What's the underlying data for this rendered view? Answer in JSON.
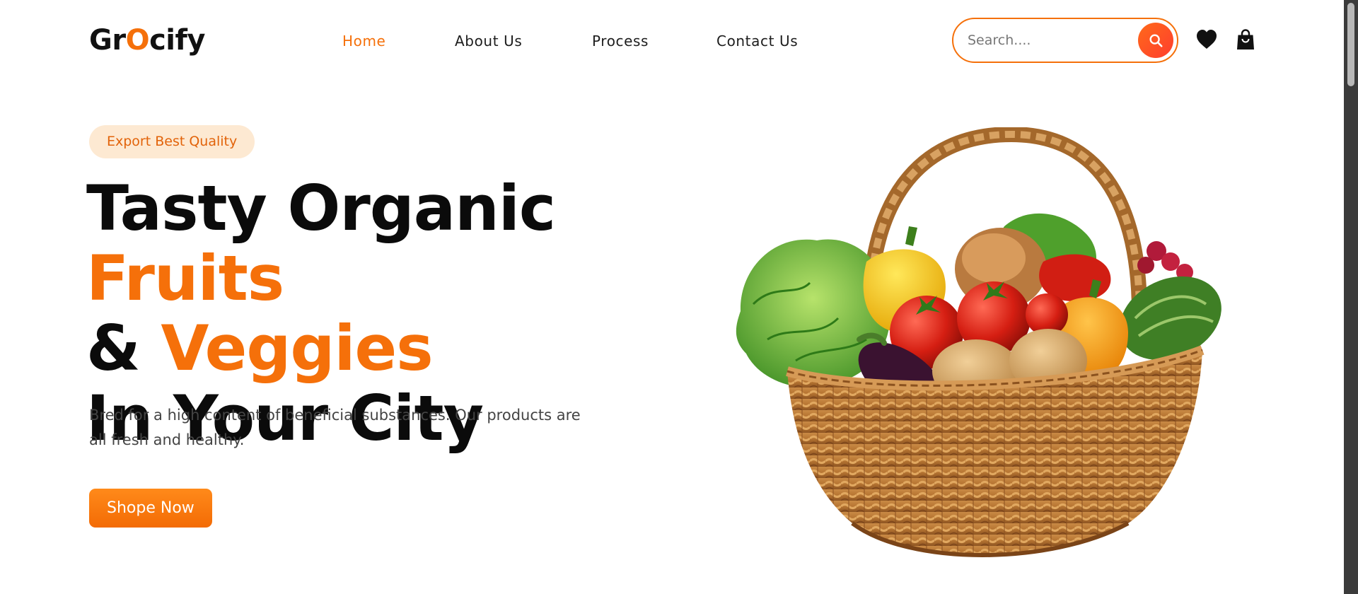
{
  "brand": {
    "logo_prefix": "Gr",
    "logo_accent": "O",
    "logo_suffix": "cify"
  },
  "nav": {
    "items": [
      {
        "label": "Home",
        "active": true
      },
      {
        "label": "About Us",
        "active": false
      },
      {
        "label": "Process",
        "active": false
      },
      {
        "label": "Contact Us",
        "active": false
      }
    ]
  },
  "search": {
    "placeholder": "Search...."
  },
  "icons": {
    "search": "search-icon",
    "wishlist": "heart-icon",
    "cart": "shopping-bag-icon"
  },
  "hero": {
    "badge": "Export Best Quality",
    "headline": {
      "line1_plain": "Tasty Organic ",
      "line1_accent": "Fruits",
      "line2_plain": "& ",
      "line2_accent": "Veggies",
      "line3": "In Your City"
    },
    "description": "Bred for a high content of beneficial substances. Our products are all fresh and healthy.",
    "cta_label": "Shope Now"
  },
  "colors": {
    "accent": "#f5700a",
    "badge_bg": "#fde9d2",
    "text": "#0b0b0b"
  }
}
